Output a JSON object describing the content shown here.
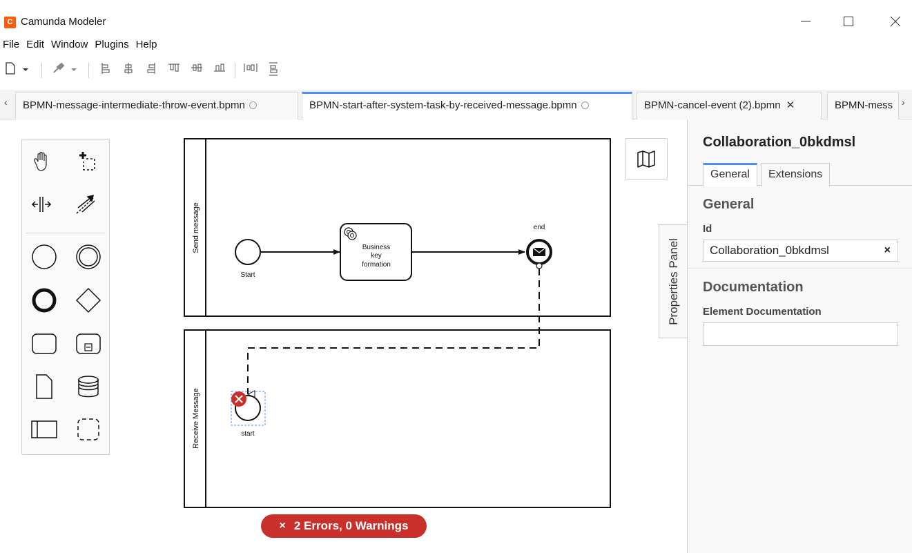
{
  "window": {
    "title": "Camunda Modeler",
    "logo_letter": "C",
    "minimize_icon": "minimize-icon",
    "maximize_icon": "maximize-icon",
    "close_icon": "close-icon"
  },
  "menu": [
    "File",
    "Edit",
    "Window",
    "Plugins",
    "Help"
  ],
  "tabs": [
    {
      "label": "BPMN-message-intermediate-throw-event.bpmn",
      "state": "unsaved"
    },
    {
      "label": "BPMN-start-after-system-task-by-received-message.bpmn",
      "state": "unsaved",
      "active": true
    },
    {
      "label": "BPMN-cancel-event (2).bpmn",
      "state": "closable"
    },
    {
      "label": "BPMN-mess",
      "state": "truncated"
    }
  ],
  "diagram": {
    "pool_top": {
      "label": "Send message"
    },
    "pool_bottom": {
      "label": "Receive Message"
    },
    "start_top": {
      "label": "Start"
    },
    "task": {
      "label_lines": [
        "Business",
        "key",
        "formation"
      ]
    },
    "end_event": {
      "label": "end"
    },
    "start_bottom": {
      "label": "start"
    }
  },
  "error_badge": {
    "icon": "×",
    "text": "2 Errors, 0 Warnings"
  },
  "properties_toggle": "Properties Panel",
  "properties": {
    "title": "Collaboration_0bkdmsl",
    "tabs": [
      "General",
      "Extensions"
    ],
    "group_general": "General",
    "id_label": "Id",
    "id_value": "Collaboration_0bkdmsl",
    "clear_icon": "×",
    "group_documentation": "Documentation",
    "doc_label": "Element Documentation",
    "doc_value": ""
  },
  "colors": {
    "accent": "#4d90fe",
    "error": "#c9302c",
    "logo": "#fc5d0d"
  }
}
